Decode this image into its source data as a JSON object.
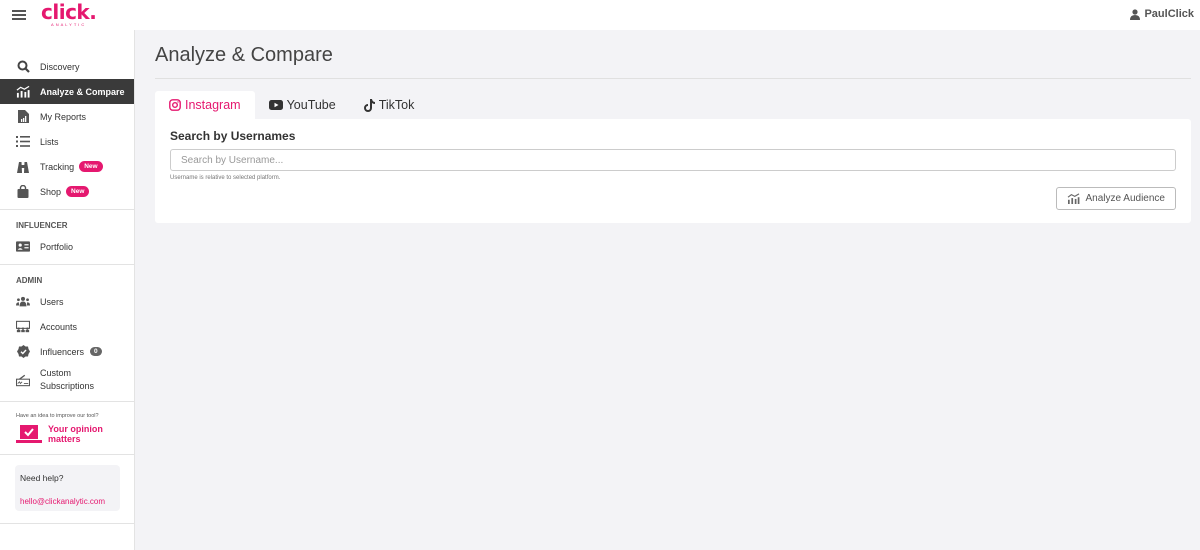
{
  "app": {
    "logo_text": "click.",
    "logo_subtext": "ANALYTIC",
    "user_name": "PaulClick",
    "brand_color": "#e5186f"
  },
  "sidebar": {
    "items": [
      {
        "label": "Discovery",
        "icon": "search-icon"
      },
      {
        "label": "Analyze & Compare",
        "icon": "chart-icon",
        "active": true
      },
      {
        "label": "My Reports",
        "icon": "report-icon"
      },
      {
        "label": "Lists",
        "icon": "list-icon"
      },
      {
        "label": "Tracking",
        "icon": "binoculars-icon",
        "badge": "New"
      },
      {
        "label": "Shop",
        "icon": "shopping-bag-icon",
        "badge": "New"
      }
    ],
    "influencer_section": {
      "label": "INFLUENCER",
      "items": [
        {
          "label": "Portfolio",
          "icon": "id-card-icon"
        }
      ]
    },
    "admin_section": {
      "label": "ADMIN",
      "items": [
        {
          "label": "Users",
          "icon": "users-icon"
        },
        {
          "label": "Accounts",
          "icon": "accounts-icon"
        },
        {
          "label": "Influencers",
          "icon": "verified-badge-icon",
          "count": "0"
        },
        {
          "label_line1": "Custom",
          "label_line2": "Subscriptions",
          "icon": "signature-icon"
        }
      ]
    },
    "feedback": {
      "prompt": "Have an idea to improve our tool?",
      "link_line1": "Your opinion",
      "link_line2": "matters"
    },
    "help": {
      "title": "Need help?",
      "email": "hello@clickanalytic.com"
    }
  },
  "main": {
    "page_title": "Analyze & Compare",
    "tabs": [
      {
        "label": "Instagram",
        "icon": "instagram-icon",
        "active": true
      },
      {
        "label": "YouTube",
        "icon": "youtube-icon"
      },
      {
        "label": "TikTok",
        "icon": "tiktok-icon"
      }
    ],
    "search": {
      "title": "Search by Usernames",
      "placeholder": "Search by Username...",
      "value": "",
      "hint": "Username is relative to selected platform."
    },
    "analyze_button_label": "Analyze Audience"
  }
}
